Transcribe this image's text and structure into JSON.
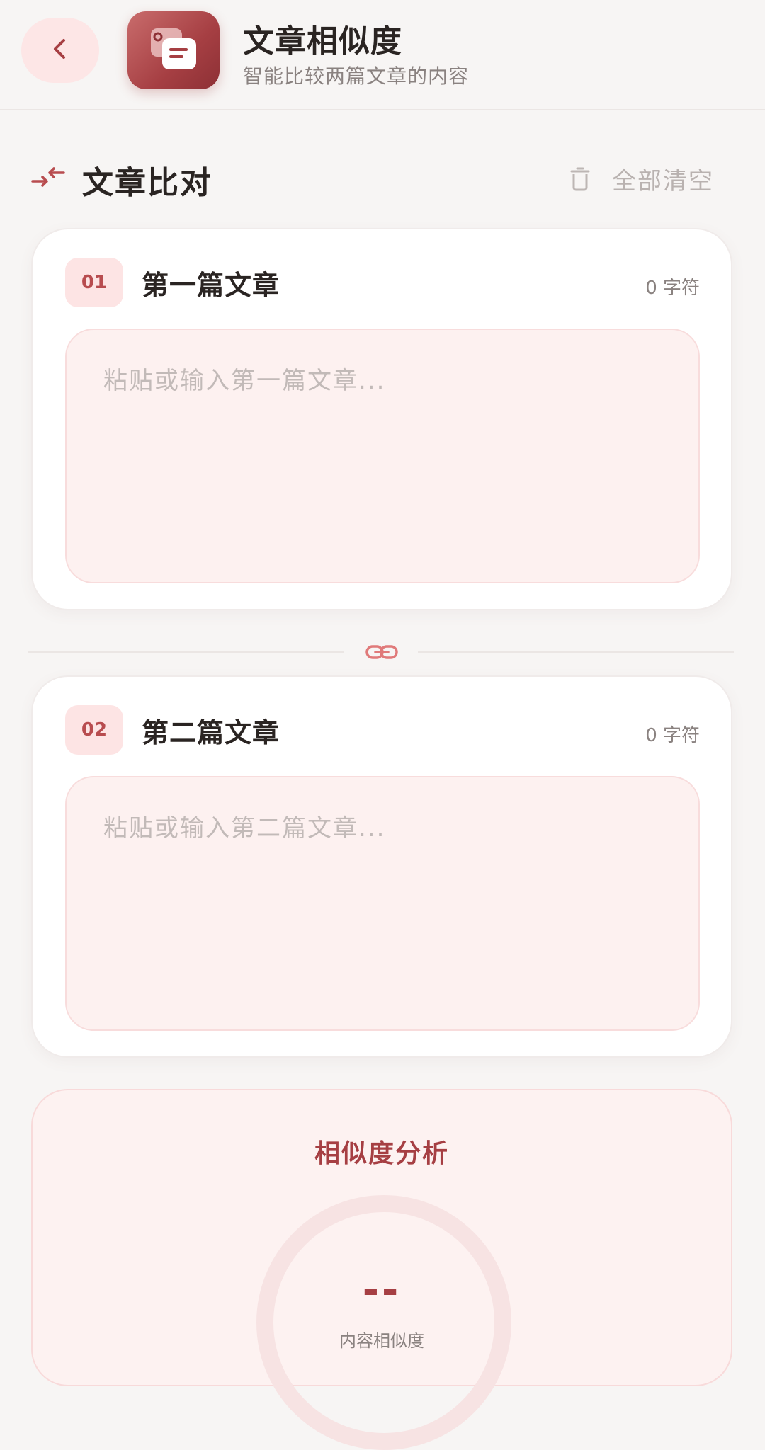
{
  "header": {
    "title": "文章相似度",
    "subtitle": "智能比较两篇文章的内容",
    "back_icon": "chevron-left-icon",
    "app_icon": "document-compare-icon"
  },
  "section": {
    "title": "文章比对",
    "icon": "compare-arrows-icon",
    "clear_all_label": "全部清空",
    "clear_icon": "trash-icon"
  },
  "articles": [
    {
      "number": "01",
      "title": "第一篇文章",
      "char_count": "0 字符",
      "placeholder": "粘贴或输入第一篇文章...",
      "value": ""
    },
    {
      "number": "02",
      "title": "第二篇文章",
      "char_count": "0 字符",
      "placeholder": "粘贴或输入第二篇文章...",
      "value": ""
    }
  ],
  "divider_icon": "link-icon",
  "analysis": {
    "title": "相似度分析",
    "score": "--",
    "score_label": "内容相似度"
  },
  "colors": {
    "accent": "#a63f43",
    "accent_light": "#fde4e4",
    "background": "#f7f5f4",
    "input_bg": "#fdf1f0"
  }
}
